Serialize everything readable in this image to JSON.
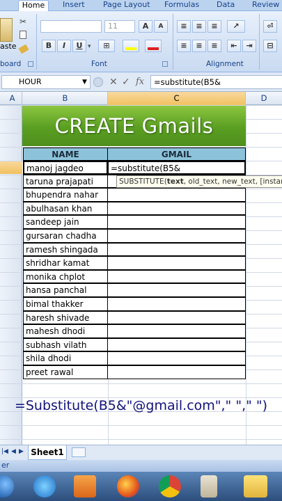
{
  "ribbon": {
    "tabs": [
      "Home",
      "Insert",
      "Page Layout",
      "Formulas",
      "Data",
      "Review"
    ],
    "partial_labels": {
      "paste": "aste",
      "clipboard": "board"
    },
    "font_size": "11",
    "groups": {
      "font": "Font",
      "alignment": "Alignment"
    },
    "font_buttons": {
      "bold": "B",
      "italic": "I",
      "underline": "U"
    }
  },
  "formula_bar": {
    "name_box": "HOUR",
    "cancel_symbol": "✕",
    "enter_symbol": "✓",
    "fx_symbol": "fx",
    "formula": "=substitute(B5&"
  },
  "columns": [
    "A",
    "B",
    "C",
    "D"
  ],
  "banner": {
    "title": "CREATE Gmails"
  },
  "table": {
    "headers": {
      "name": "NAME",
      "gmail": "GMAIL"
    },
    "active_cell_value": "=substitute(B5&",
    "names": [
      "manoj jagdeo",
      "taruna prajapati",
      "bhupendra nahar",
      "abulhasan khan",
      "sandeep jain",
      "gursaran chadha",
      "ramesh shingada",
      "shridhar kamat",
      "monika chplot",
      "hansa panchal",
      "bimal thakker",
      "haresh shivade",
      "mahesh dhodi",
      "subhash vilath",
      "shila dhodi",
      "preet rawal"
    ]
  },
  "tooltip": {
    "func": "SUBSTITUTE(",
    "arg_current": "text",
    "args_rest": ", old_text, new_text, [instance_num])"
  },
  "overlay_formula": "=Substitute(B5&\"@gmail.com\",\"  \",\" \")",
  "sheet_tabs": {
    "active": "Sheet1"
  },
  "status_bar": {
    "mode": "er"
  },
  "colors": {
    "banner_green": "#5a9e22",
    "header_blue": "#8dc3da",
    "ribbon_blue": "#15428b"
  }
}
